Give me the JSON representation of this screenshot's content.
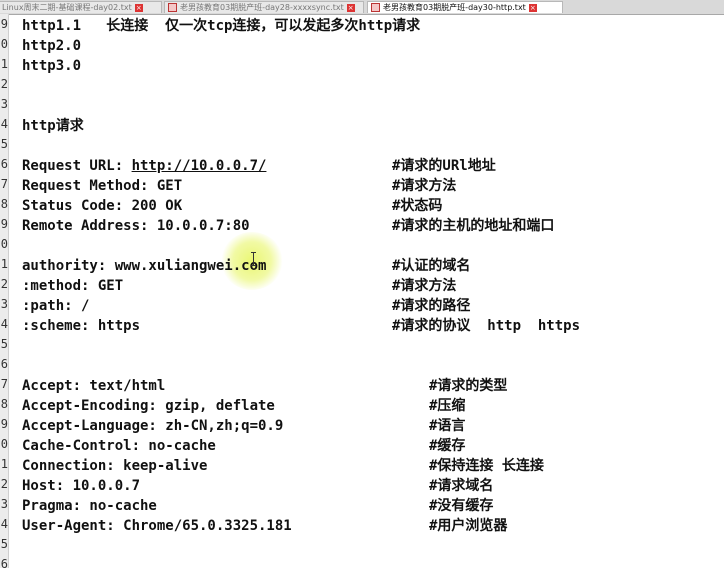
{
  "tabs": [
    {
      "label": "Linux周末二期-基础课程-day02.txt",
      "active": false
    },
    {
      "label": "老男孩教育03期脱产班-day28-xxxxsync.txt",
      "active": false
    },
    {
      "label": "老男孩教育03期脱产班-day30-http.txt",
      "active": true
    }
  ],
  "gutter": {
    "line_numbers": [
      "9",
      "0",
      "1",
      "2",
      "3",
      "4",
      "5",
      "6",
      "7",
      "8",
      "9",
      "0",
      "1",
      "2",
      "3",
      "4",
      "5",
      "6",
      "7",
      "8",
      "9",
      "0",
      "1",
      "2",
      "3",
      "4",
      "5",
      "6"
    ]
  },
  "content": {
    "http11": "http1.1   长连接  仅一次tcp连接，可以发起多次http请求",
    "http20": "http2.0",
    "http30": "http3.0",
    "section_title": "http请求",
    "req_url_label": "Request URL: ",
    "req_url_value": "http://10.0.0.7/",
    "req_url_comment": "#请求的URl地址",
    "req_method": "Request Method: GET",
    "req_method_comment": "#请求方法",
    "status_code": "Status Code: 200 OK",
    "status_code_comment": "#状态码",
    "remote_addr": "Remote Address: 10.0.0.7:80",
    "remote_addr_comment": "#请求的主机的地址和端口",
    "authority": "authority: www.xuliangwei.com",
    "authority_comment": "#认证的域名",
    "method": ":method: GET",
    "method_comment": "#请求方法",
    "path": ":path: /",
    "path_comment": "#请求的路径",
    "scheme": ":scheme: https",
    "scheme_comment": "#请求的协议  http  https",
    "accept": "Accept: text/html",
    "accept_comment": "#请求的类型",
    "accept_encoding": "Accept-Encoding: gzip, deflate",
    "accept_encoding_comment": "#压缩",
    "accept_language": "Accept-Language: zh-CN,zh;q=0.9",
    "accept_language_comment": "#语言",
    "cache_control": "Cache-Control: no-cache",
    "cache_control_comment": "#缓存",
    "connection": "Connection: keep-alive",
    "connection_comment": "#保持连接 长连接",
    "host": "Host: 10.0.0.7",
    "host_comment": "#请求域名",
    "pragma": "Pragma: no-cache",
    "pragma_comment": "#没有缓存",
    "user_agent": "User-Agent: Chrome/65.0.3325.181",
    "user_agent_comment": "#用户浏览器"
  }
}
